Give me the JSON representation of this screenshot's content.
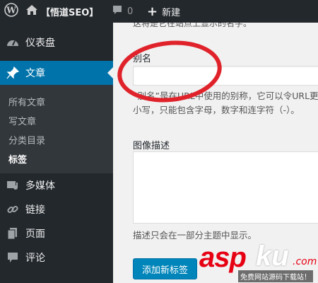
{
  "admin_bar": {
    "wp_icon": "wordpress-icon",
    "site_name": "【悟道SEO】",
    "comments_icon": "speech-bubble-icon",
    "comments_count": "0",
    "new_icon": "plus-icon",
    "new_label": "新建"
  },
  "sidebar": {
    "items": [
      {
        "icon": "dashboard-icon",
        "label": "仪表盘"
      },
      {
        "icon": "pin-icon",
        "label": "文章",
        "current": true
      },
      {
        "icon": "media-icon",
        "label": "多媒体"
      },
      {
        "icon": "link-icon",
        "label": "链接"
      },
      {
        "icon": "page-icon",
        "label": "页面"
      },
      {
        "icon": "comment-icon",
        "label": "评论"
      }
    ],
    "submenu": [
      {
        "label": "所有文章"
      },
      {
        "label": "写文章"
      },
      {
        "label": "分类目录"
      },
      {
        "label": "标签",
        "current": true
      }
    ]
  },
  "form": {
    "top_cut_text": "这将是它在站点上显示的名字。",
    "slug_label": "别名",
    "slug_value": "",
    "slug_desc_line1": "“别名”是在URL中使用的别称，它可以令URL更",
    "slug_desc_line2": "小写，只能包含字母，数字和连字符（-）。",
    "description_label": "图像描述",
    "description_value": "",
    "description_help": "描述只会在一部分主题中显示。",
    "submit_label": "添加新标签"
  },
  "watermark": {
    "brand_red": "asp",
    "brand_white": "ku",
    "brand_suffix": ".com",
    "tagline": "免费网站源码下载站！"
  },
  "colors": {
    "admin_bar": "#23282d",
    "sidebar": "#23282d",
    "submenu": "#32373c",
    "accent": "#0073aa",
    "button": "#0085ba",
    "annotation_red": "#e0232b"
  }
}
